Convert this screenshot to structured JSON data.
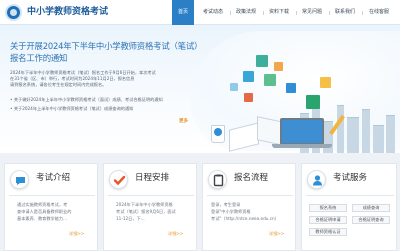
{
  "header": {
    "site_title": "中小学教师资格考试",
    "nav": [
      "首页",
      "考试动态",
      "政策法规",
      "资料下载",
      "常见问题",
      "联系我们",
      "在线客服"
    ]
  },
  "banner": {
    "headline": "关于开展2024年下半年中小学教师资格考试（笔试）报名工作的通知",
    "paragraph": [
      "2024年下半年中小学教师资格考试（笔试）报名工作于9月6日开始，本次考试",
      "在31个省（区、市）举行，考试时间为2024年11月2日，报名信息",
      "请到报名系统，请各位考生在规定时间内完成报名。"
    ],
    "bullets": [
      "关于做好2024年上半年中小学教师资格考试（面试）成绩、考试合格证明的通知",
      "关于2024年上半年中小学教师资格考试（笔试）成绩查询的通知"
    ],
    "more": "更多"
  },
  "cards": {
    "intro": {
      "title": "考试介绍",
      "text": [
        "通过实施教师资格考试，考",
        "查申请人是否具备教师职业的",
        "基本素养、教育教学能力..."
      ],
      "more": "详细>>"
    },
    "schedule": {
      "title": "日程安排",
      "text": [
        "2024年下半年中小学教师资格",
        "考试（笔试）报名9月6日，面试",
        "11-12日，下..."
      ],
      "more": "详细>>"
    },
    "process": {
      "title": "报名流程",
      "text": [
        "登录\"中小学教师资格",
        "考试\"（http://ntce.neea.edu.cn）"
      ],
      "prefix": "登录，考生登录",
      "more": "详细>>"
    },
    "service": {
      "title": "考试服务",
      "buttons": [
        "报名系统",
        "成绩查询",
        "合格证明申请",
        "合格证明查询",
        "教师资格认证"
      ]
    }
  },
  "colors": {
    "primary": "#2a7fc7",
    "accent": "#e6962d",
    "intro_icon": "#2e8ed6",
    "schedule_icon": "#e9542d",
    "process_icon": "#444",
    "service_icon": "#2e8ed6"
  }
}
